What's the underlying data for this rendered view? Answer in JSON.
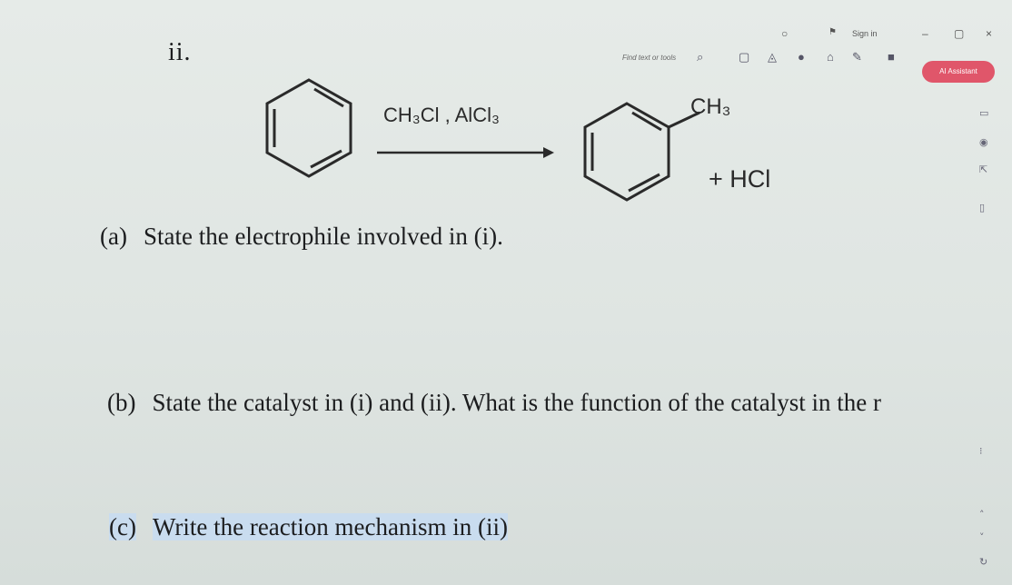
{
  "window": {
    "sign_in": "Sign in",
    "controls": [
      "○",
      "–",
      "▢",
      "×"
    ]
  },
  "toolbar": {
    "find_text": "Find text or tools",
    "search_icon": "search-icon",
    "ai_button": "AI Assistant"
  },
  "question": {
    "number": "ii.",
    "reaction": {
      "reagent": "CH₃Cl , AlCl₃",
      "substituent": "CH₃",
      "byproduct": "+ HCl"
    },
    "parts": [
      {
        "label": "(a)",
        "text": "State the electrophile involved in (i)."
      },
      {
        "label": "(b)",
        "text": "State the catalyst in (i) and (ii). What is the function of the catalyst in the r"
      },
      {
        "label": "(c)",
        "text": "Write the reaction mechanism in (ii)"
      }
    ]
  }
}
